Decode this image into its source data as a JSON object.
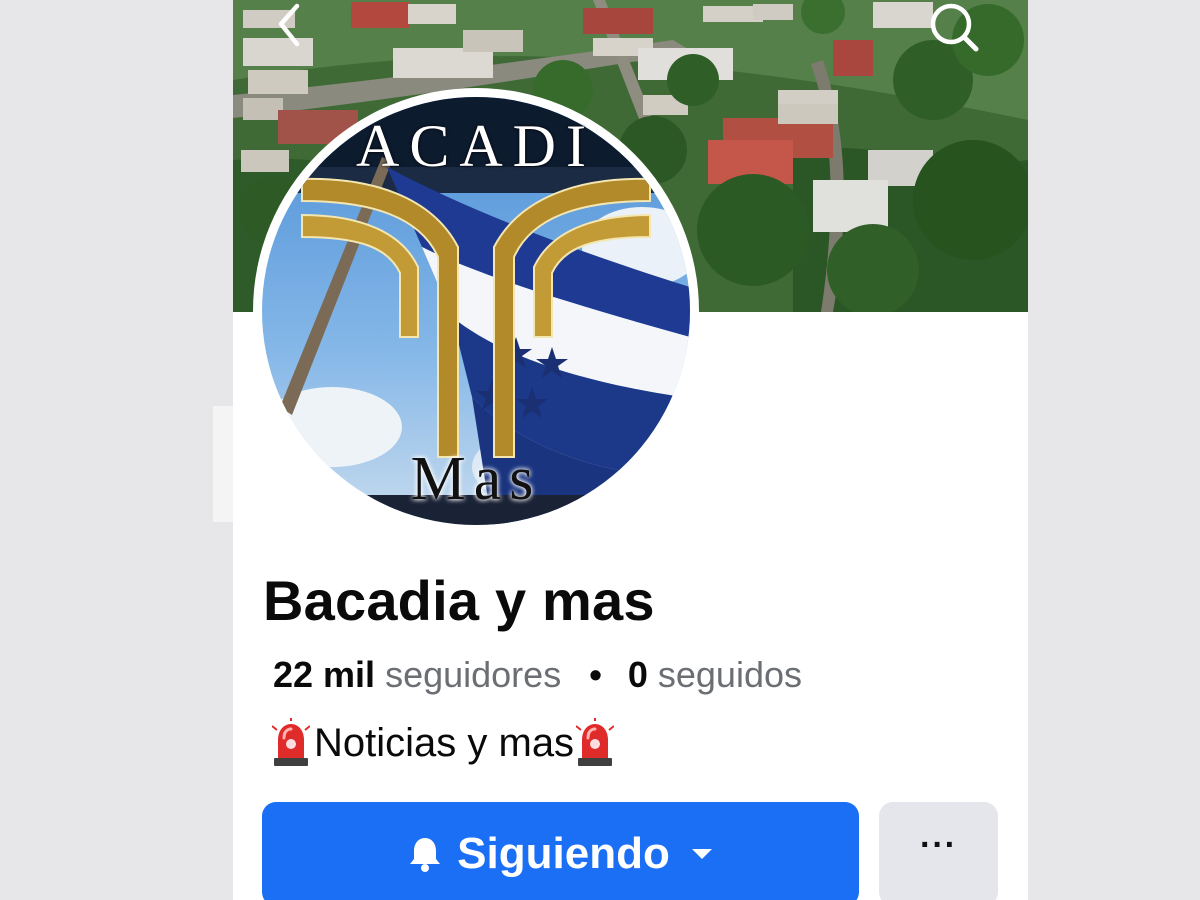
{
  "page": {
    "name": "Bacadia y mas",
    "followers_count": "22 mil",
    "followers_label": "seguidores",
    "separator": "•",
    "following_count": "0",
    "following_label": "seguidos",
    "bio": "Noticias y mas",
    "bio_emoji": "siren-emoji"
  },
  "avatar": {
    "logo_top_text": "ACADI",
    "logo_bottom_text": "Mas"
  },
  "header": {
    "back_icon": "chevron-left-icon",
    "search_icon": "search-icon"
  },
  "actions": {
    "follow_label": "Siguiendo",
    "follow_icon": "bell-icon",
    "follow_menu_icon": "caret-down-icon",
    "more_label": "···"
  },
  "colors": {
    "primary": "#1a6ff5",
    "secondary_button": "#e4e6eb",
    "muted_text": "#6b6e73",
    "flag_blue": "#1f3a93",
    "logo_gold": "#b38a2a"
  }
}
